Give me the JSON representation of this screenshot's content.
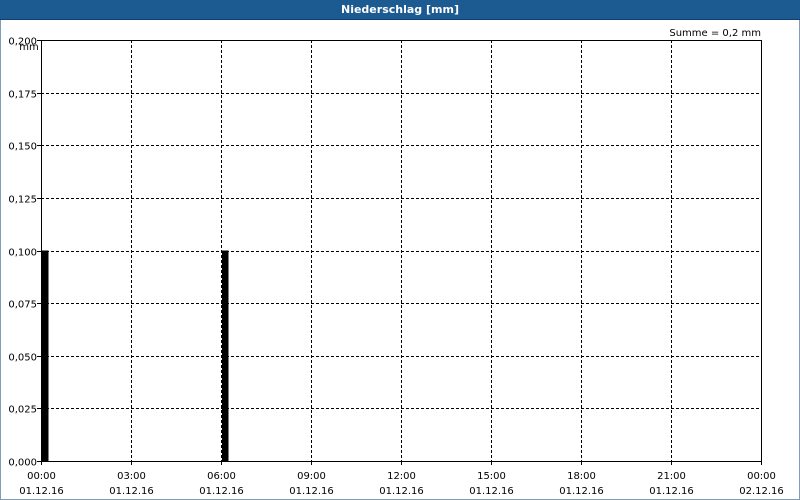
{
  "chart_data": {
    "type": "bar",
    "title": "Niederschlag [mm]",
    "ylabel": "mm",
    "xlabel": "",
    "sum_label": "Summe = 0,2 mm",
    "ylim": [
      0,
      0.2
    ],
    "xlim_hours": [
      0,
      24
    ],
    "grid": true,
    "bar_width_hours": 0.25,
    "y_ticks": [
      "0,000",
      "0,025",
      "0,050",
      "0,075",
      "0,100",
      "0,125",
      "0,150",
      "0,175",
      "0,200"
    ],
    "x_ticks": [
      {
        "time": "00:00",
        "date": "01.12.16"
      },
      {
        "time": "03:00",
        "date": "01.12.16"
      },
      {
        "time": "06:00",
        "date": "01.12.16"
      },
      {
        "time": "09:00",
        "date": "01.12.16"
      },
      {
        "time": "12:00",
        "date": "01.12.16"
      },
      {
        "time": "15:00",
        "date": "01.12.16"
      },
      {
        "time": "18:00",
        "date": "01.12.16"
      },
      {
        "time": "21:00",
        "date": "01.12.16"
      },
      {
        "time": "00:00",
        "date": "02.12.16"
      }
    ],
    "series": [
      {
        "values": [
          {
            "x": "01.12.16 00:00",
            "y": 0.1
          },
          {
            "x": "01.12.16 06:00",
            "y": 0.1
          }
        ]
      }
    ],
    "colors": {
      "bar": "#000000",
      "title_bg": "#1c5a92",
      "grid": "#000000"
    }
  }
}
